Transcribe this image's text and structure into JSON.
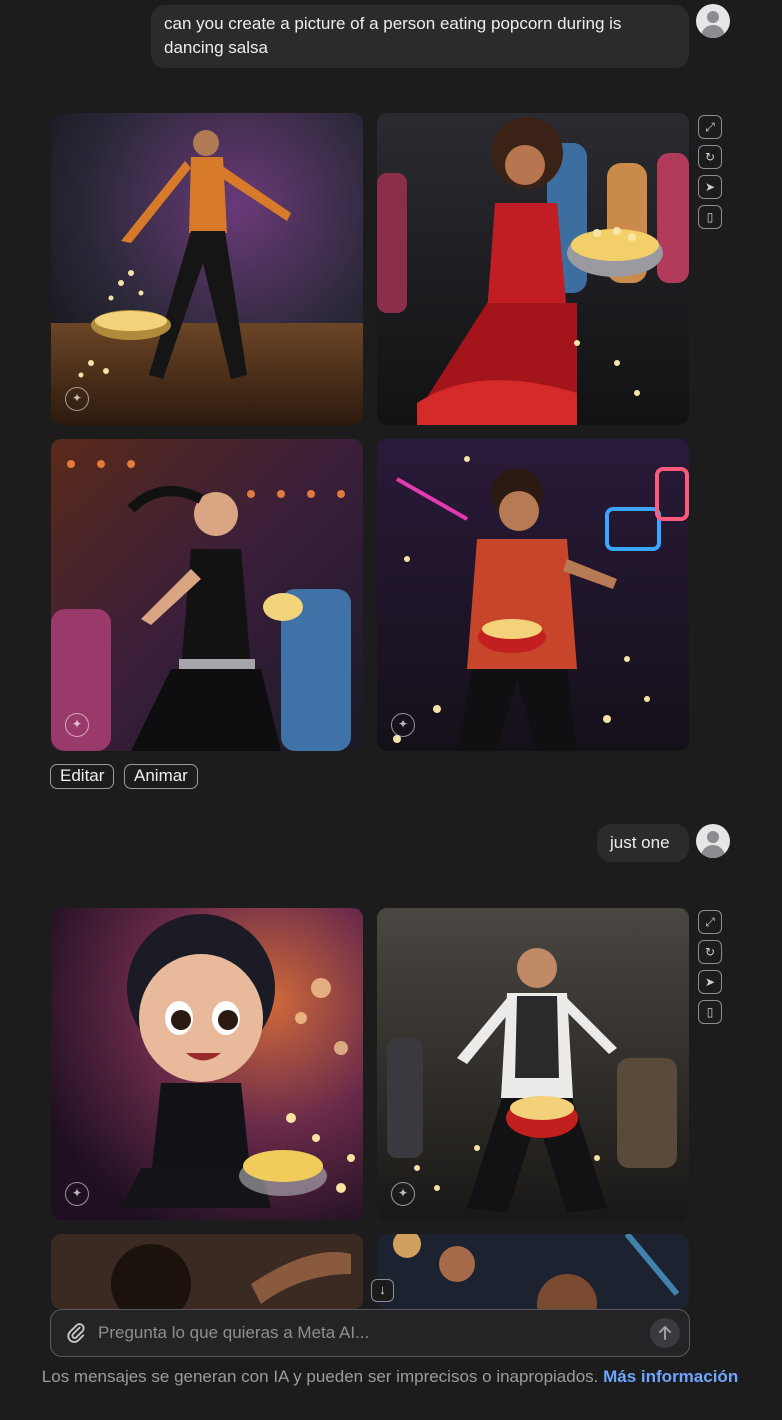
{
  "messages": {
    "first_prompt": "can you create a picture of a person eating popcorn during is dancing salsa",
    "second_prompt": "just one"
  },
  "actions": {
    "edit_label": "Editar",
    "animate_label": "Animar",
    "icons": [
      "expand-icon",
      "regenerate-icon",
      "share-icon",
      "save-icon"
    ]
  },
  "composer": {
    "placeholder": "Pregunta lo que quieras a Meta AI..."
  },
  "footer": {
    "disclaimer": "Los mensajes se generan con IA y pueden ser imprecisos o inapropiados.",
    "link": "Más información"
  },
  "colors": {
    "background": "#1c1c1d",
    "bubble": "#2b2b2e",
    "link": "#6ea6ff"
  }
}
